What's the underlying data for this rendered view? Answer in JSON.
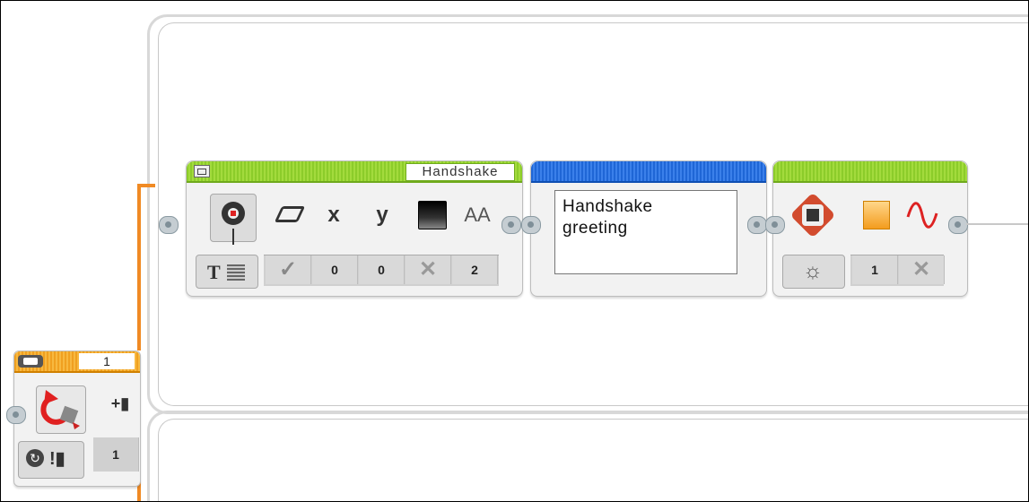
{
  "display_block": {
    "title": "Handshake",
    "params": [
      "0",
      "0",
      "2"
    ],
    "icons": [
      "display-brick-icon",
      "eraser-icon",
      "x-icon",
      "y-icon",
      "color-icon",
      "font-size-icon",
      "text-grid-mode-icon",
      "check-icon",
      "cross-icon"
    ],
    "x_label": "x",
    "y_label": "y",
    "font_label": "AA",
    "text_mode_label": "T"
  },
  "text_block": {
    "text_line1": "Handshake",
    "text_line2": "greeting"
  },
  "light_block": {
    "params": [
      "1"
    ],
    "icons": [
      "brick-light-icon",
      "orange-color-icon",
      "pulse-icon",
      "light-mode-icon",
      "cross-icon"
    ]
  },
  "loop_block": {
    "label": "1",
    "side_value": "1",
    "icons": [
      "loop-arrow-icon",
      "interrupt-icon",
      "count-icon",
      "loop-index-icon"
    ]
  },
  "colors": {
    "green_header": "#8ccc2a",
    "blue_header": "#1f66d6",
    "orange_header": "#f0a020",
    "wire_orange": "#f08a24"
  }
}
